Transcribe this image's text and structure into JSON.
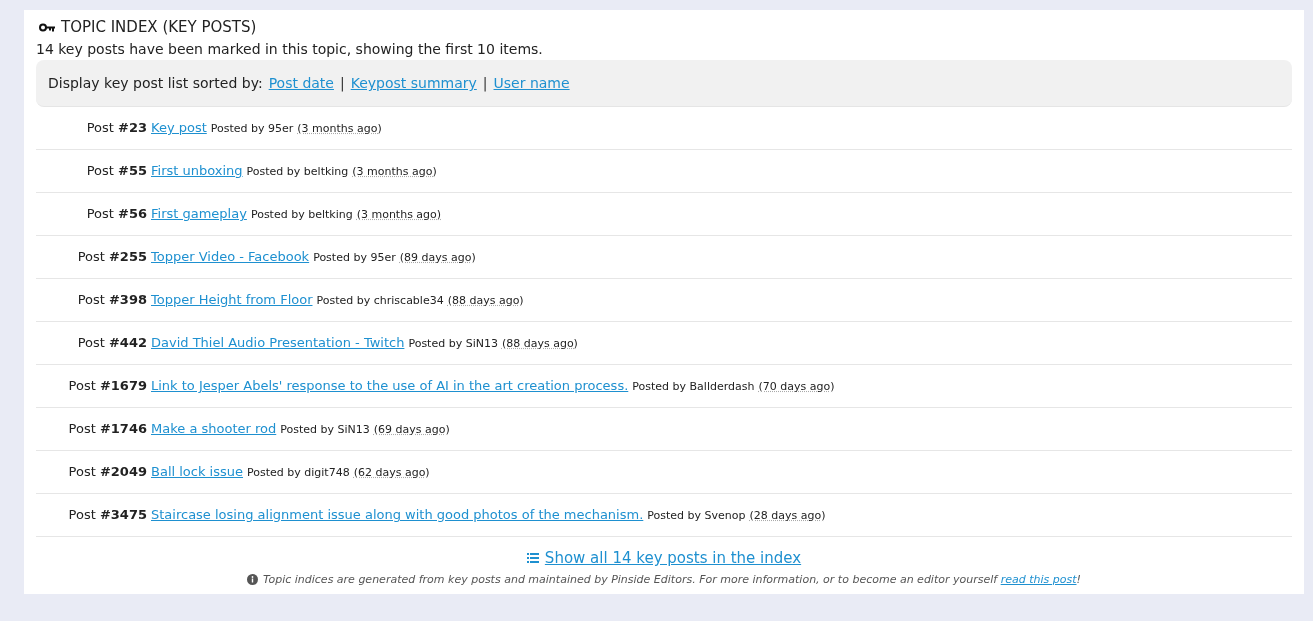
{
  "panel": {
    "title": "TOPIC INDEX (KEY POSTS)",
    "summary": "14 key posts have been marked in this topic, showing the first 10 items."
  },
  "sort_bar": {
    "label": "Display key post list sorted by:",
    "options": [
      {
        "label": "Post date"
      },
      {
        "label": "Keypost summary"
      },
      {
        "label": "User name"
      }
    ],
    "separator": "|"
  },
  "posts": [
    {
      "label": "Post **#23**",
      "title": "Key post",
      "posted_by": "Posted by 95er",
      "time": "(3 months ago)"
    },
    {
      "label": "Post **#55**",
      "title": "First unboxing",
      "posted_by": "Posted by beltking",
      "time": "(3 months ago)"
    },
    {
      "label": "Post **#56**",
      "title": "First gameplay",
      "posted_by": "Posted by beltking",
      "time": "(3 months ago)"
    },
    {
      "label": "Post **#255**",
      "title": "Topper Video - Facebook",
      "posted_by": "Posted by 95er",
      "time": "(89 days ago)"
    },
    {
      "label": "Post **#398**",
      "title": "Topper Height from Floor",
      "posted_by": "Posted by chriscable34",
      "time": "(88 days ago)"
    },
    {
      "label": "Post **#442**",
      "title": "David Thiel Audio Presentation - Twitch",
      "posted_by": "Posted by SiN13",
      "time": "(88 days ago)"
    },
    {
      "label": "Post **#1679**",
      "title": "Link to Jesper Abels' response to the use of AI in the art creation process.",
      "posted_by": "Posted by Ballderdash",
      "time": "(70 days ago)"
    },
    {
      "label": "Post **#1746**",
      "title": "Make a shooter rod",
      "posted_by": "Posted by SiN13",
      "time": "(69 days ago)"
    },
    {
      "label": "Post **#2049**",
      "title": "Ball lock issue",
      "posted_by": "Posted by digit748",
      "time": "(62 days ago)"
    },
    {
      "label": "Post **#3475**",
      "title": "Staircase losing alignment issue along with good photos of the mechanism.",
      "posted_by": "Posted by Svenop",
      "time": "(28 days ago)"
    }
  ],
  "footer": {
    "show_all": "Show all 14 key posts in the index",
    "note": "Topic indices are generated from key posts and maintained by Pinside Editors. For more information, or to become an editor yourself",
    "note_link": "read this post",
    "note_end": "!"
  }
}
